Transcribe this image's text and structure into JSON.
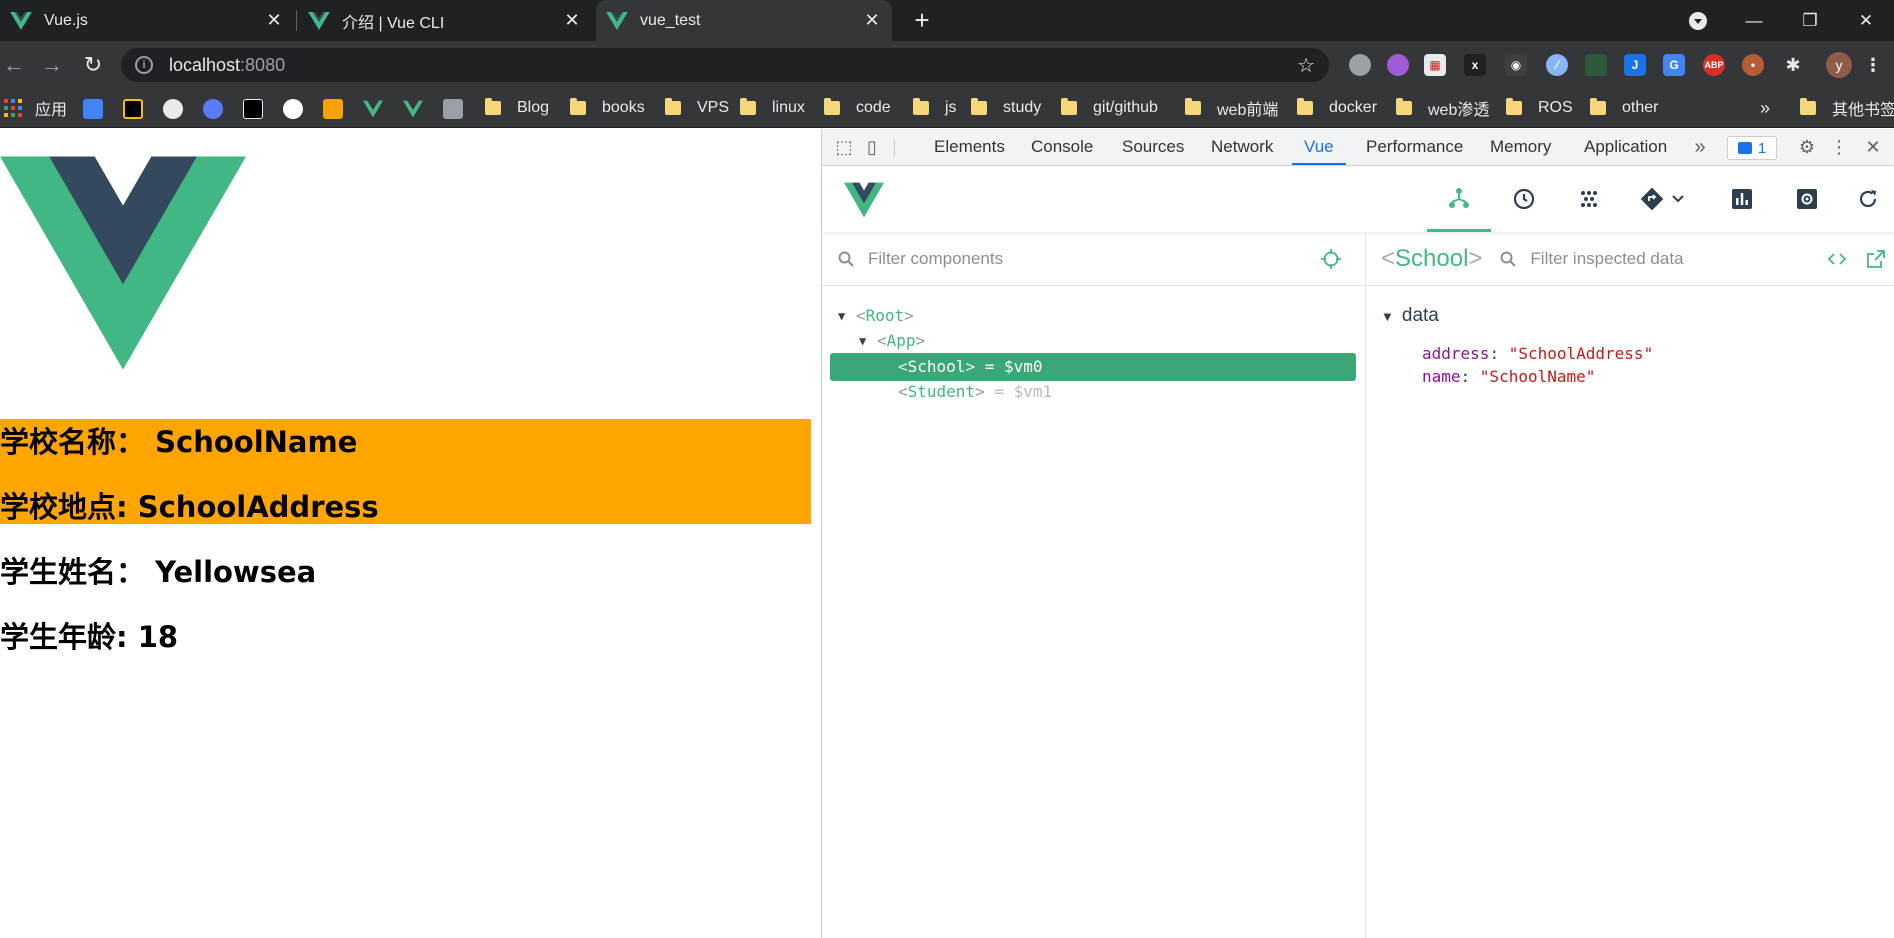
{
  "browser": {
    "tabs": [
      {
        "title": "Vue.js",
        "active": false
      },
      {
        "title": "介绍 | Vue CLI",
        "active": false
      },
      {
        "title": "vue_test",
        "active": true
      }
    ],
    "url_host": "localhost",
    "url_port": ":8080",
    "avatar_letter": "y",
    "bookmarks": {
      "apps": "应用",
      "folders": [
        "Blog",
        "books",
        "VPS",
        "linux",
        "code",
        "js",
        "study",
        "git/github",
        "web前端",
        "docker",
        "web渗透",
        "ROS",
        "other"
      ],
      "other_bookmarks": "其他书签"
    }
  },
  "page": {
    "school_name_label": "学校名称：",
    "school_name": "SchoolName",
    "school_address_label": "学校地点:",
    "school_address": "SchoolAddress",
    "student_name_label": "学生姓名：",
    "student_name": "Yellowsea",
    "student_age_label": "学生年龄:",
    "student_age": "18",
    "school_box_color": "#ffa500"
  },
  "devtools": {
    "tabs": [
      "Elements",
      "Console",
      "Sources",
      "Network",
      "Vue",
      "Performance",
      "Memory",
      "Application"
    ],
    "active_tab": "Vue",
    "issues_count": "1",
    "vue": {
      "filter_components_placeholder": "Filter components",
      "filter_data_placeholder": "Filter inspected data",
      "tree": [
        {
          "name": "Root",
          "depth": 0,
          "expanded": true,
          "selected": false,
          "vm": ""
        },
        {
          "name": "App",
          "depth": 1,
          "expanded": true,
          "selected": false,
          "vm": ""
        },
        {
          "name": "School",
          "depth": 2,
          "expanded": false,
          "selected": true,
          "vm": "= $vm0"
        },
        {
          "name": "Student",
          "depth": 2,
          "expanded": false,
          "selected": false,
          "vm": "= $vm1"
        }
      ],
      "inspected_component": "School",
      "data_section_label": "data",
      "data_fields": [
        {
          "key": "address",
          "value": "\"SchoolAddress\""
        },
        {
          "key": "name",
          "value": "\"SchoolName\""
        }
      ],
      "accent_color": "#42b883",
      "selected_color": "#3ba776"
    }
  }
}
